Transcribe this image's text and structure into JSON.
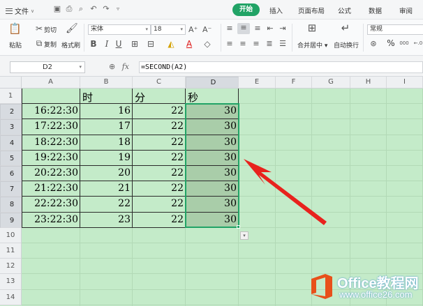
{
  "menu": {
    "file_label": "文件",
    "tabs": [
      "开始",
      "插入",
      "页面布局",
      "公式",
      "数据",
      "审阅"
    ],
    "active_tab": "开始"
  },
  "ribbon": {
    "paste": "粘贴",
    "cut": "剪切",
    "copy": "复制",
    "format_painter": "格式刷",
    "font_name": "宋体",
    "font_size": "18",
    "merge_center": "合并居中",
    "wrap_text": "自动换行",
    "number_format": "常规",
    "percent_sign": "%"
  },
  "formula_bar": {
    "name_box": "D2",
    "fx_label": "fx",
    "formula": "=SECOND(A2)"
  },
  "sheet": {
    "columns": [
      "A",
      "B",
      "C",
      "D",
      "E",
      "F",
      "G",
      "H",
      "I"
    ],
    "selected_column": "D",
    "rows": [
      "1",
      "2",
      "3",
      "4",
      "5",
      "6",
      "7",
      "8",
      "9",
      "10",
      "11",
      "12",
      "13",
      "14"
    ],
    "headers": {
      "b": "时",
      "c": "分",
      "d": "秒"
    },
    "data": [
      {
        "a": "16:22:30",
        "b": "16",
        "c": "22",
        "d": "30"
      },
      {
        "a": "17:22:30",
        "b": "17",
        "c": "22",
        "d": "30"
      },
      {
        "a": "18:22:30",
        "b": "18",
        "c": "22",
        "d": "30"
      },
      {
        "a": "19:22:30",
        "b": "19",
        "c": "22",
        "d": "30"
      },
      {
        "a": "20:22:30",
        "b": "20",
        "c": "22",
        "d": "30"
      },
      {
        "a": "21:22:30",
        "b": "21",
        "c": "22",
        "d": "30"
      },
      {
        "a": "22:22:30",
        "b": "22",
        "c": "22",
        "d": "30"
      },
      {
        "a": "23:22:30",
        "b": "23",
        "c": "22",
        "d": "30"
      }
    ]
  },
  "watermark": {
    "brand": "Office教程网",
    "url": "www.office26.com"
  },
  "colors": {
    "accent": "#21a366",
    "sheet_background": "#c4ebc9",
    "selection_fill": "#a9cda9",
    "annotation_arrow": "#e8221d",
    "logo_orange": "#e8501a"
  }
}
